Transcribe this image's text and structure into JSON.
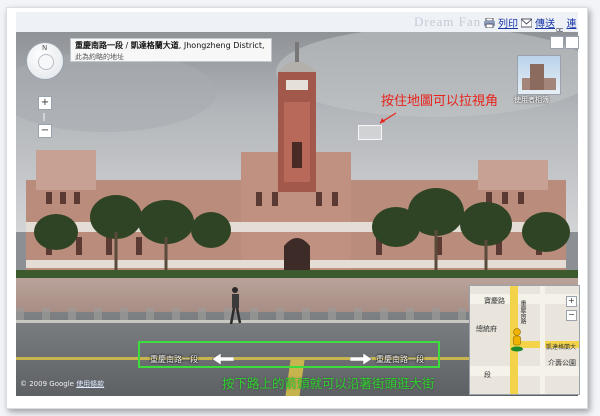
{
  "topbar": {
    "watermark": "Dream Fan",
    "links": [
      {
        "label": "列印",
        "icon": "printer-icon"
      },
      {
        "label": "傳送",
        "icon": "mail-icon"
      },
      {
        "label": "連結",
        "icon": "link-icon"
      }
    ],
    "close": "✕"
  },
  "address": {
    "road1": "重慶南路一段",
    "separator": " / ",
    "road2": "凱達格蘭大道",
    "district": ", Jhongzheng District, 台灣",
    "sub": "此為約略的地址"
  },
  "thumbnail": {
    "caption": "使用者相簿"
  },
  "annotations": {
    "drag_hint": "按住地圖可以拉視角",
    "street_hint": "按下路上的箭頭就可以沿著街頭逛大街"
  },
  "streets": {
    "left": "重慶南路一段",
    "right": "重慶南路一段"
  },
  "copyright": {
    "text": "© 2009 Google",
    "link": "使用條款"
  },
  "minimap": {
    "labels": {
      "top": "寶慶路",
      "left_top": "總統府",
      "right_v": "重慶南路",
      "right_bottom": "凱達格蘭大",
      "bottom_right": "介壽公園",
      "bottom_left": "段"
    },
    "zoom_in": "+",
    "zoom_out": "−"
  },
  "controls": {
    "zoom_in": "+",
    "zoom_out": "−",
    "north": "N"
  },
  "colors": {
    "annotation_red": "#e8231c",
    "annotation_green": "#2fd12f",
    "highlight_box": "#3cdd3c"
  }
}
